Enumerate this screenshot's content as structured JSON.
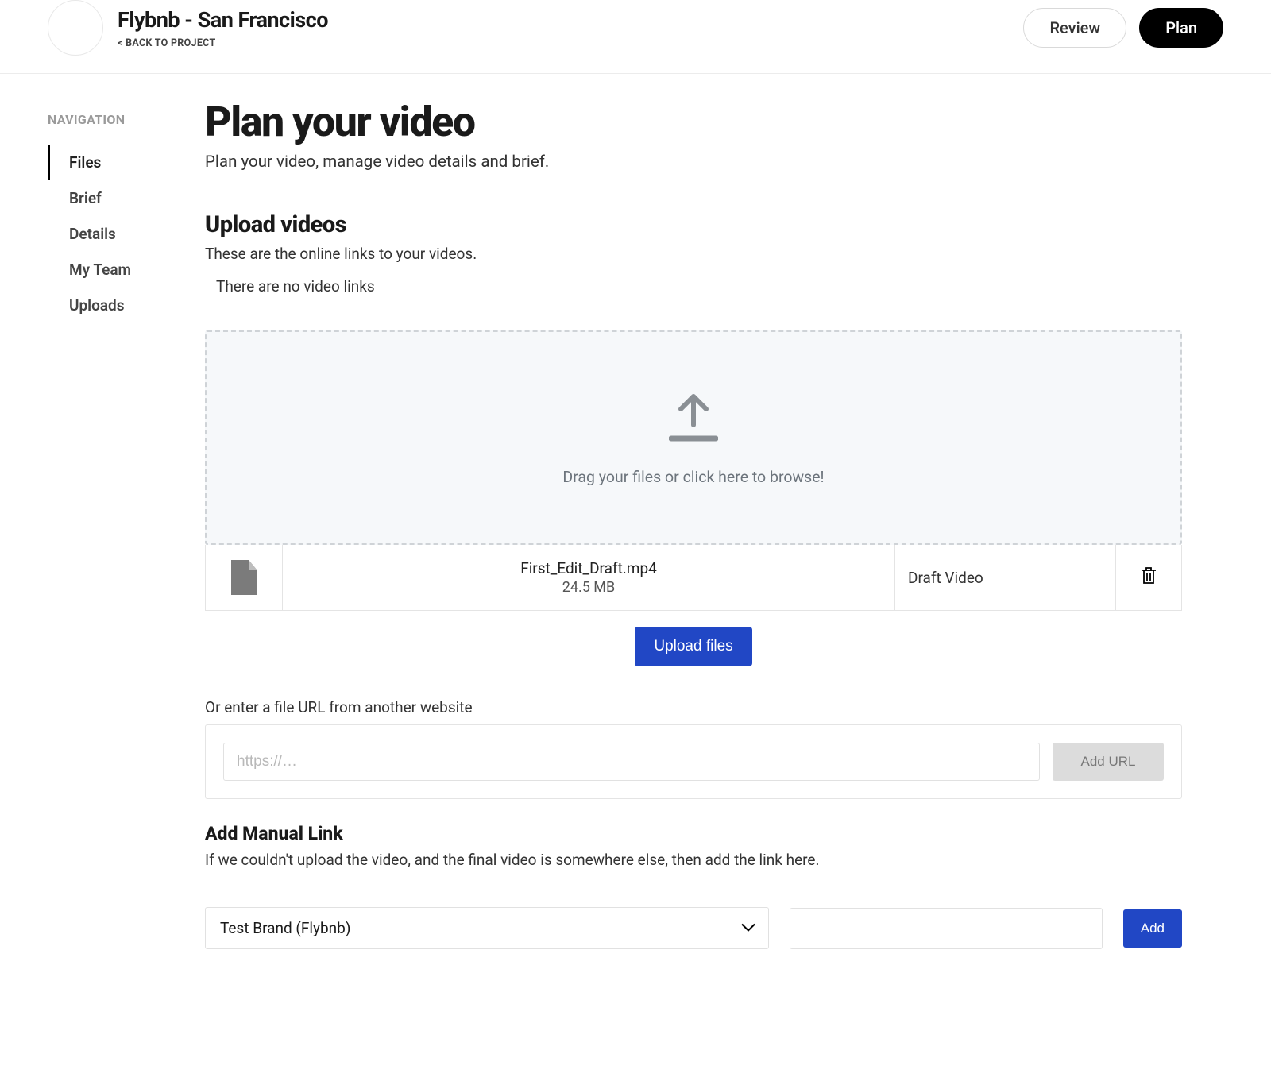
{
  "header": {
    "project_title": "Flybnb - San Francisco",
    "back_link": "< BACK TO PROJECT",
    "review_label": "Review",
    "plan_label": "Plan"
  },
  "sidebar": {
    "heading": "NAVIGATION",
    "items": [
      {
        "label": "Files",
        "active": true
      },
      {
        "label": "Brief",
        "active": false
      },
      {
        "label": "Details",
        "active": false
      },
      {
        "label": "My Team",
        "active": false
      },
      {
        "label": "Uploads",
        "active": false
      }
    ]
  },
  "main": {
    "title": "Plan your video",
    "subtitle": "Plan your video, manage video details and brief.",
    "upload_section": {
      "title": "Upload videos",
      "subtitle": "These are the online links to your videos.",
      "empty_text": "There are no video links",
      "dropzone_text": "Drag your files or click here to browse!",
      "file": {
        "name": "First_Edit_Draft.mp4",
        "size": "24.5 MB",
        "type": "Draft Video"
      },
      "upload_button": "Upload files"
    },
    "url_section": {
      "label": "Or enter a file URL from another website",
      "placeholder": "https://…",
      "button": "Add URL"
    },
    "manual_section": {
      "title": "Add Manual Link",
      "subtitle": "If we couldn't upload the video, and the final video is somewhere else, then add the link here.",
      "select_value": "Test Brand (Flybnb)",
      "add_button": "Add"
    }
  }
}
